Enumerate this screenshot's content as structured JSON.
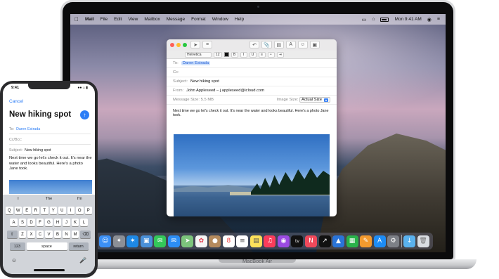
{
  "mac": {
    "label": "MacBook Air",
    "menubar": {
      "app": "Mail",
      "items": [
        "File",
        "Edit",
        "View",
        "Mailbox",
        "Message",
        "Format",
        "Window",
        "Help"
      ],
      "clock": "Mon 9:41 AM"
    },
    "mail": {
      "font": "Helvetica",
      "font_size": "12",
      "to_label": "To:",
      "to_value": "Daren Estrada",
      "cc_label": "Cc:",
      "subject_label": "Subject:",
      "subject_value": "New hiking spot",
      "from_label": "From:",
      "from_value": "John Appleseed – j.appleseed@icloud.com",
      "message_size_label": "Message Size:",
      "message_size_value": "5.5 MB",
      "image_size_label": "Image Size:",
      "image_size_value": "Actual Size",
      "body": "Next time we go let's check it out. It's near the water and looks beautiful. Here's a photo Jane took."
    },
    "dock": [
      "finder-icon",
      "launchpad-icon",
      "safari-icon",
      "photos-app-icon",
      "messages-icon",
      "mail-icon",
      "maps-icon",
      "photos-icon",
      "contacts-icon",
      "calendar-icon",
      "reminders-icon",
      "notes-icon",
      "music-icon",
      "podcasts-icon",
      "tv-icon",
      "news-icon",
      "stocks-icon",
      "keynote-icon",
      "numbers-icon",
      "pages-icon",
      "app-store-icon",
      "system-preferences-icon",
      "downloads-folder-icon",
      "trash-icon"
    ],
    "calendar_day": "8",
    "tv_label": "tv"
  },
  "phone": {
    "time": "9:41",
    "cancel": "Cancel",
    "title": "New hiking spot",
    "to_label": "To:",
    "to_value": "Daren Estrada",
    "ccbcc_label": "Cc/Bcc:",
    "subject_label": "Subject:",
    "subject_value": "New hiking spot",
    "body": "Next time we go let's check it out. It's near the water and looks beautiful. Here's a photo Jane took.",
    "suggestions": [
      "I",
      "The",
      "I'm"
    ],
    "rows": [
      [
        "Q",
        "W",
        "E",
        "R",
        "T",
        "Y",
        "U",
        "I",
        "O",
        "P"
      ],
      [
        "A",
        "S",
        "D",
        "F",
        "G",
        "H",
        "J",
        "K",
        "L"
      ],
      [
        "Z",
        "X",
        "C",
        "V",
        "B",
        "N",
        "M"
      ]
    ],
    "key_123": "123",
    "key_space": "space",
    "key_return": "return"
  }
}
